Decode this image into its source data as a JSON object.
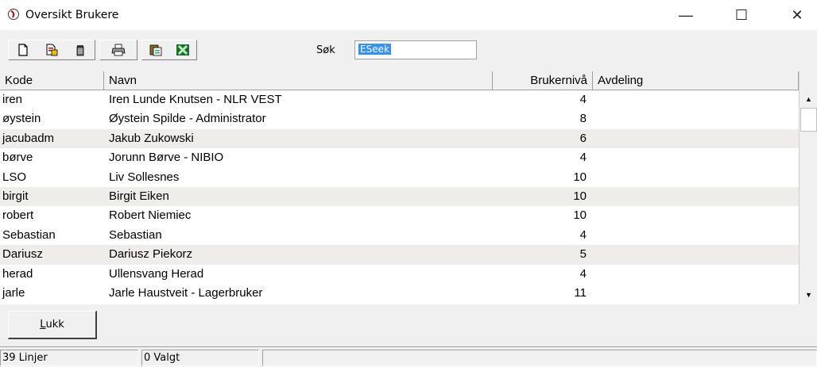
{
  "window": {
    "title": "Oversikt Brukere",
    "minimize": "—",
    "maximize": "☐",
    "close": "✕"
  },
  "toolbar": {
    "search_label": "Søk",
    "search_value": "ESeek",
    "icons": [
      "new-doc-icon",
      "edit-doc-icon",
      "delete-icon",
      "print-icon",
      "copy-icon",
      "excel-icon"
    ]
  },
  "grid": {
    "columns": [
      "Kode",
      "Navn",
      "Brukernivå",
      "Avdeling"
    ],
    "rows": [
      {
        "kode": "iren",
        "navn": "Iren Lunde Knutsen - NLR VEST",
        "niva": "4",
        "avd": ""
      },
      {
        "kode": "øystein",
        "navn": "Øystein Spilde - Administrator",
        "niva": "8",
        "avd": ""
      },
      {
        "kode": "jacubadm",
        "navn": "Jakub Zukowski",
        "niva": "6",
        "avd": ""
      },
      {
        "kode": "børve",
        "navn": "Jorunn Børve - NIBIO",
        "niva": "4",
        "avd": ""
      },
      {
        "kode": "LSO",
        "navn": "Liv Sollesnes",
        "niva": "10",
        "avd": ""
      },
      {
        "kode": "birgit",
        "navn": "Birgit Eiken",
        "niva": "10",
        "avd": ""
      },
      {
        "kode": "robert",
        "navn": "Robert Niemiec",
        "niva": "10",
        "avd": ""
      },
      {
        "kode": "Sebastian",
        "navn": "Sebastian",
        "niva": "4",
        "avd": ""
      },
      {
        "kode": "Dariusz",
        "navn": "Dariusz Piekorz",
        "niva": "5",
        "avd": ""
      },
      {
        "kode": "herad",
        "navn": "Ullensvang Herad",
        "niva": "4",
        "avd": ""
      },
      {
        "kode": "jarle",
        "navn": "Jarle Haustveit - Lagerbruker",
        "niva": "11",
        "avd": ""
      }
    ]
  },
  "close_button": {
    "mnemonic": "L",
    "rest": "ukk"
  },
  "statusbar": {
    "lines": "39 Linjer",
    "selected": "0 Valgt",
    "extra": ""
  }
}
